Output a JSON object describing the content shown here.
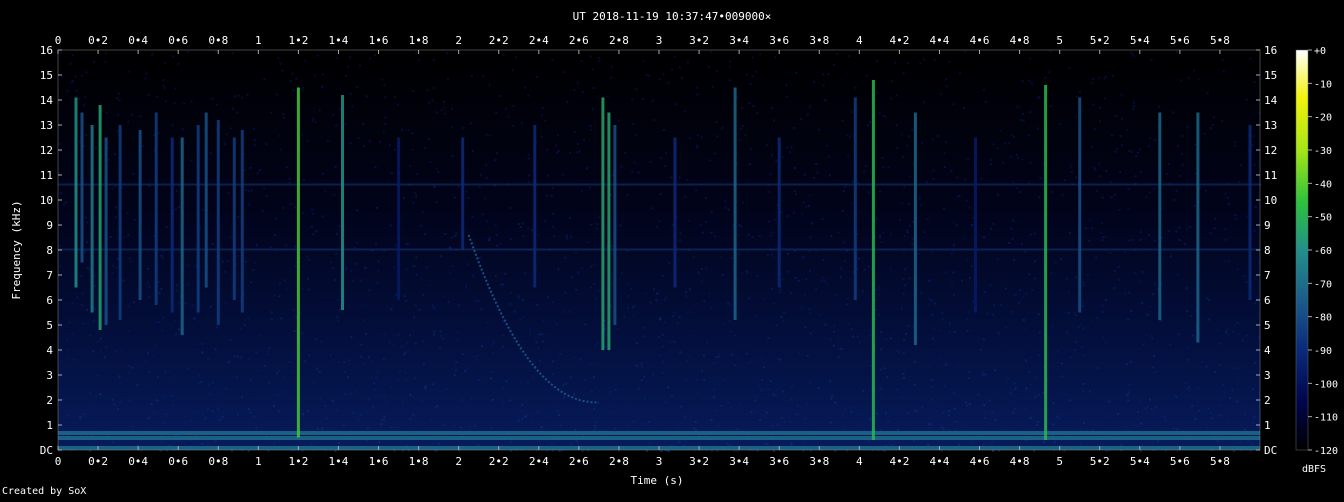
{
  "chart_data": {
    "type": "heatmap",
    "title": "UT 2018-11-19 10:37:47•009000×",
    "xlabel": "Time (s)",
    "ylabel": "Frequency (kHz)",
    "xlim": [
      0,
      5.98
    ],
    "ylim": [
      0,
      16
    ],
    "x_ticks": [
      "0",
      "0•2",
      "0•4",
      "0•6",
      "0•8",
      "1",
      "1•2",
      "1•4",
      "1•6",
      "1•8",
      "2",
      "2•2",
      "2•4",
      "2•6",
      "2•8",
      "3",
      "3•2",
      "3•4",
      "3•6",
      "3•8",
      "4",
      "4•2",
      "4•4",
      "4•6",
      "4•8",
      "5",
      "5•2",
      "5•4",
      "5•6",
      "5•8"
    ],
    "y_ticks": [
      "DC",
      "1",
      "2",
      "3",
      "4",
      "5",
      "6",
      "7",
      "8",
      "9",
      "10",
      "11",
      "12",
      "13",
      "14",
      "15",
      "16"
    ],
    "colorbar": {
      "label": "dBFS",
      "ticks": [
        "+0",
        "-10",
        "-20",
        "-30",
        "-40",
        "-50",
        "-60",
        "-70",
        "-80",
        "-90",
        "-100",
        "-110",
        "-120"
      ],
      "range": [
        -120,
        0
      ]
    },
    "events": [
      {
        "t": 0.09,
        "f_low": 6.5,
        "f_high": 14.1,
        "level": 0.5
      },
      {
        "t": 0.12,
        "f_low": 7.5,
        "f_high": 13.5,
        "level": 0.35
      },
      {
        "t": 0.17,
        "f_low": 5.5,
        "f_high": 13.0,
        "level": 0.45
      },
      {
        "t": 0.21,
        "f_low": 4.8,
        "f_high": 13.8,
        "level": 0.55
      },
      {
        "t": 0.24,
        "f_low": 5.0,
        "f_high": 12.5,
        "level": 0.35
      },
      {
        "t": 0.31,
        "f_low": 5.2,
        "f_high": 13.0,
        "level": 0.3
      },
      {
        "t": 0.41,
        "f_low": 6.0,
        "f_high": 12.8,
        "level": 0.35
      },
      {
        "t": 0.49,
        "f_low": 5.8,
        "f_high": 13.5,
        "level": 0.3
      },
      {
        "t": 0.57,
        "f_low": 5.5,
        "f_high": 12.5,
        "level": 0.25
      },
      {
        "t": 0.62,
        "f_low": 4.6,
        "f_high": 12.5,
        "level": 0.4
      },
      {
        "t": 0.7,
        "f_low": 5.5,
        "f_high": 13.0,
        "level": 0.3
      },
      {
        "t": 0.74,
        "f_low": 6.5,
        "f_high": 13.5,
        "level": 0.35
      },
      {
        "t": 0.8,
        "f_low": 5.0,
        "f_high": 13.2,
        "level": 0.3
      },
      {
        "t": 0.88,
        "f_low": 6.0,
        "f_high": 12.5,
        "level": 0.3
      },
      {
        "t": 0.92,
        "f_low": 5.5,
        "f_high": 12.8,
        "level": 0.3
      },
      {
        "t": 1.2,
        "f_low": 0.5,
        "f_high": 14.5,
        "level": 0.65
      },
      {
        "t": 1.42,
        "f_low": 5.6,
        "f_high": 14.2,
        "level": 0.5
      },
      {
        "t": 1.7,
        "f_low": 6.0,
        "f_high": 12.5,
        "level": 0.2
      },
      {
        "t": 2.02,
        "f_low": 8.0,
        "f_high": 12.5,
        "level": 0.25
      },
      {
        "t": 2.38,
        "f_low": 6.5,
        "f_high": 13.0,
        "level": 0.25
      },
      {
        "t": 2.72,
        "f_low": 4.0,
        "f_high": 14.1,
        "level": 0.55
      },
      {
        "t": 2.75,
        "f_low": 4.0,
        "f_high": 13.5,
        "level": 0.55
      },
      {
        "t": 2.78,
        "f_low": 5.0,
        "f_high": 13.0,
        "level": 0.35
      },
      {
        "t": 3.08,
        "f_low": 6.5,
        "f_high": 12.5,
        "level": 0.25
      },
      {
        "t": 3.38,
        "f_low": 5.2,
        "f_high": 14.5,
        "level": 0.4
      },
      {
        "t": 3.6,
        "f_low": 6.5,
        "f_high": 12.5,
        "level": 0.25
      },
      {
        "t": 3.98,
        "f_low": 6.0,
        "f_high": 14.1,
        "level": 0.3
      },
      {
        "t": 4.07,
        "f_low": 0.4,
        "f_high": 14.8,
        "level": 0.6
      },
      {
        "t": 4.28,
        "f_low": 4.2,
        "f_high": 13.5,
        "level": 0.4
      },
      {
        "t": 4.58,
        "f_low": 5.5,
        "f_high": 12.5,
        "level": 0.2
      },
      {
        "t": 4.93,
        "f_low": 0.4,
        "f_high": 14.6,
        "level": 0.6
      },
      {
        "t": 5.1,
        "f_low": 5.5,
        "f_high": 14.1,
        "level": 0.35
      },
      {
        "t": 5.5,
        "f_low": 5.2,
        "f_high": 13.5,
        "level": 0.4
      },
      {
        "t": 5.69,
        "f_low": 4.3,
        "f_high": 13.5,
        "level": 0.4
      },
      {
        "t": 5.95,
        "f_low": 6.0,
        "f_high": 13.0,
        "level": 0.25
      }
    ],
    "sweep": {
      "t_start": 2.05,
      "f_start": 8.6,
      "t_end": 2.7,
      "f_end": 1.9,
      "level": 0.35
    },
    "hum_bands_khz": [
      0.1,
      0.5,
      0.7,
      10.6,
      8.0
    ]
  },
  "footer": {
    "credit": "Created by SoX"
  },
  "colors": {
    "colormap": [
      "#000000",
      "#00054a",
      "#0a2a7a",
      "#1b5a8a",
      "#22908a",
      "#2cc23c",
      "#a5e616",
      "#f2f20a",
      "#ffffff"
    ]
  }
}
